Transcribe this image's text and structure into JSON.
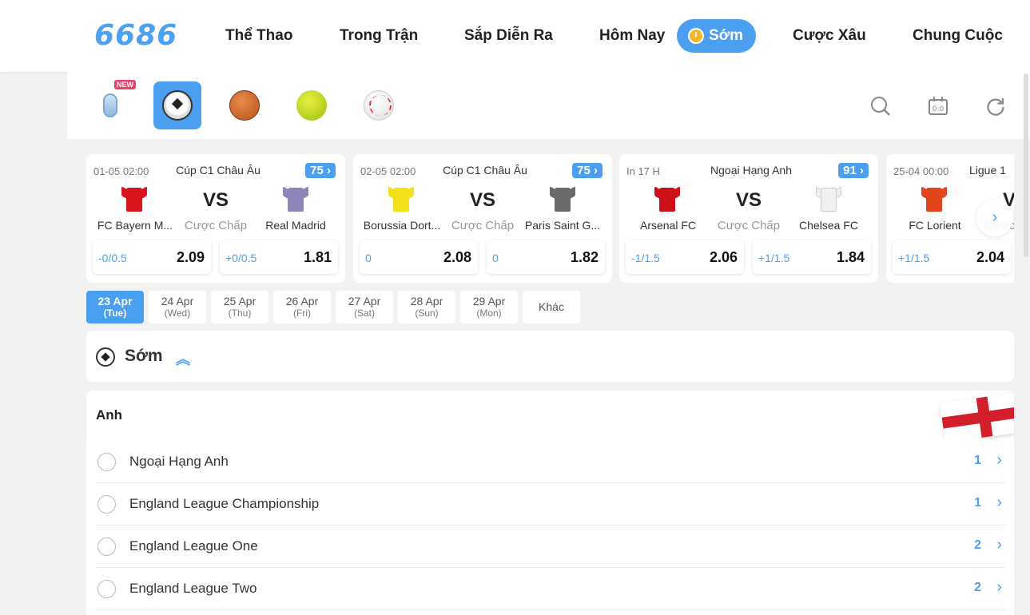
{
  "brand": {
    "logo": "6686",
    "accent": "#4b9ff0"
  },
  "nav": [
    {
      "label": "Thể Thao"
    },
    {
      "label": "Trong Trận"
    },
    {
      "label": "Sắp Diễn Ra"
    },
    {
      "label": "Hôm Nay"
    },
    {
      "label": "Sớm",
      "active": true
    },
    {
      "label": "Cược Xâu"
    },
    {
      "label": "Chung Cuộc"
    }
  ],
  "sports": {
    "new_badge": "NEW",
    "items": [
      "microphone-icon",
      "soccer-icon",
      "basketball-icon",
      "tennis-icon",
      "baseball-icon"
    ],
    "active": "soccer-icon"
  },
  "tools": [
    "search-icon",
    "scoreboard-icon",
    "refresh-icon"
  ],
  "matches": [
    {
      "time": "01-05 02:00",
      "league": "Cúp C1 Châu Âu",
      "count": "75",
      "home": "FC Bayern M...",
      "away": "Real Madrid",
      "vs": "VS",
      "handicap": "Cược Chấp",
      "home_line": "-0/0.5",
      "home_odd": "2.09",
      "away_line": "+0/0.5",
      "away_odd": "1.81",
      "home_color": "#d8141c",
      "away_color": "#8c87b8"
    },
    {
      "time": "02-05 02:00",
      "league": "Cúp C1 Châu Âu",
      "count": "75",
      "home": "Borussia Dort...",
      "away": "Paris Saint G...",
      "vs": "VS",
      "handicap": "Cược Chấp",
      "home_line": "0",
      "home_odd": "2.08",
      "away_line": "0",
      "away_odd": "1.82",
      "home_color": "#f2e11a",
      "away_color": "#6a6a6a"
    },
    {
      "time": "In 17 H",
      "league": "Ngoại Hạng Anh",
      "count": "91",
      "home": "Arsenal FC",
      "away": "Chelsea FC",
      "vs": "VS",
      "handicap": "Cược Chấp",
      "home_line": "-1/1.5",
      "home_odd": "2.06",
      "away_line": "+1/1.5",
      "away_odd": "1.84",
      "home_color": "#cc1218",
      "away_color": "#f0f0f0"
    },
    {
      "time": "25-04 00:00",
      "league": "Ligue 1",
      "count": "",
      "home": "FC Lorient",
      "away": "",
      "vs": "VS",
      "handicap": "Cược Chấp",
      "home_line": "+1/1.5",
      "home_odd": "2.04",
      "away_line": "",
      "away_odd": "",
      "home_color": "#e2441c",
      "away_color": "#ffffff"
    }
  ],
  "dates": [
    {
      "day": "23 Apr",
      "weekday": "(Tue)",
      "active": true
    },
    {
      "day": "24 Apr",
      "weekday": "(Wed)"
    },
    {
      "day": "25 Apr",
      "weekday": "(Thu)"
    },
    {
      "day": "26 Apr",
      "weekday": "(Fri)"
    },
    {
      "day": "27 Apr",
      "weekday": "(Sat)"
    },
    {
      "day": "28 Apr",
      "weekday": "(Sun)"
    },
    {
      "day": "29 Apr",
      "weekday": "(Mon)"
    },
    {
      "day": "Khác",
      "weekday": ""
    }
  ],
  "section": {
    "title": "Sớm"
  },
  "country": {
    "name": "Anh"
  },
  "leagues": [
    {
      "name": "Ngoại Hạng Anh",
      "count": "1"
    },
    {
      "name": "England League Championship",
      "count": "1"
    },
    {
      "name": "England League One",
      "count": "2"
    },
    {
      "name": "England League Two",
      "count": "2"
    }
  ]
}
